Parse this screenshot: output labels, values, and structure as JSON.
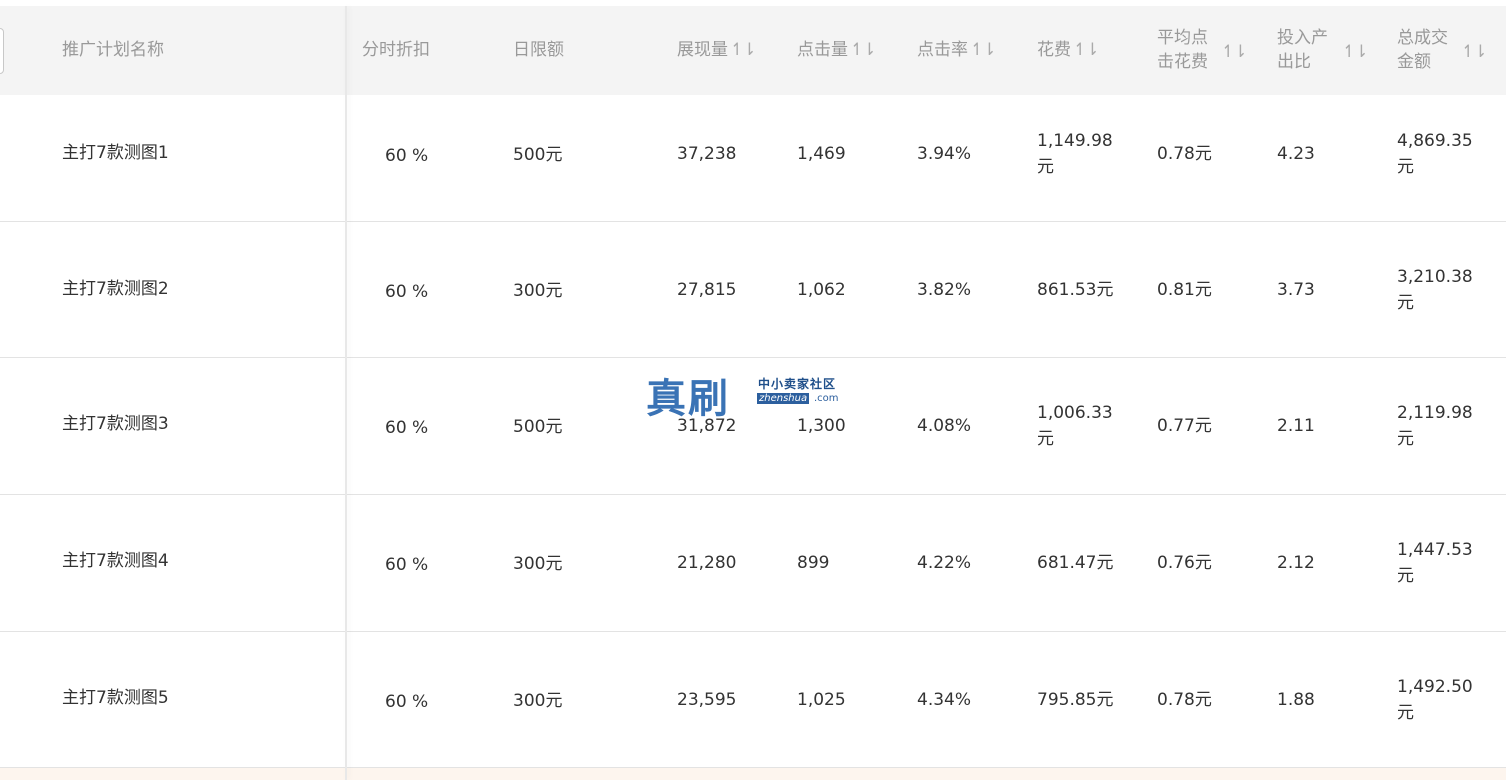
{
  "header": {
    "columns": {
      "name": "推广计划名称",
      "discount": "分时折扣",
      "daily_limit": "日限额",
      "impressions": "展现量",
      "clicks": "点击量",
      "ctr": "点击率",
      "cost": "花费",
      "avg_cpc_line1": "平均点",
      "avg_cpc_line2": "击花费",
      "roi_line1": "投入产",
      "roi_line2": "出比",
      "gmv_line1": "总成交",
      "gmv_line2": "金额"
    },
    "sort_icon": "sort-icon"
  },
  "rows": [
    {
      "name": "主打7款测图1",
      "discount": "60 %",
      "daily_limit": "500元",
      "impressions": "37,238",
      "clicks": "1,469",
      "ctr": "3.94%",
      "cost": "1,149.98元",
      "avg_cpc": "0.78元",
      "roi": "4.23",
      "gmv": "4,869.35元"
    },
    {
      "name": "主打7款测图2",
      "discount": "60 %",
      "daily_limit": "300元",
      "impressions": "27,815",
      "clicks": "1,062",
      "ctr": "3.82%",
      "cost": "861.53元",
      "avg_cpc": "0.81元",
      "roi": "3.73",
      "gmv": "3,210.38元"
    },
    {
      "name": "主打7款测图3",
      "discount": "60 %",
      "daily_limit": "500元",
      "impressions": "31,872",
      "clicks": "1,300",
      "ctr": "4.08%",
      "cost": "1,006.33元",
      "avg_cpc": "0.77元",
      "roi": "2.11",
      "gmv": "2,119.98元"
    },
    {
      "name": "主打7款测图4",
      "discount": "60 %",
      "daily_limit": "300元",
      "impressions": "21,280",
      "clicks": "899",
      "ctr": "4.22%",
      "cost": "681.47元",
      "avg_cpc": "0.76元",
      "roi": "2.12",
      "gmv": "1,447.53元"
    },
    {
      "name": "主打7款测图5",
      "discount": "60 %",
      "daily_limit": "300元",
      "impressions": "23,595",
      "clicks": "1,025",
      "ctr": "4.34%",
      "cost": "795.85元",
      "avg_cpc": "0.78元",
      "roi": "1.88",
      "gmv": "1,492.50元"
    }
  ],
  "watermark": {
    "big": "真刷",
    "small": "中小卖家社区",
    "domain": "zhenshua",
    "tld": ".com"
  },
  "colors": {
    "header_bg": "#f4f4f4",
    "header_text": "#999999",
    "cell_text": "#333333",
    "row_border": "#e3e3e3",
    "watermark_blue": "#3a73b5"
  }
}
